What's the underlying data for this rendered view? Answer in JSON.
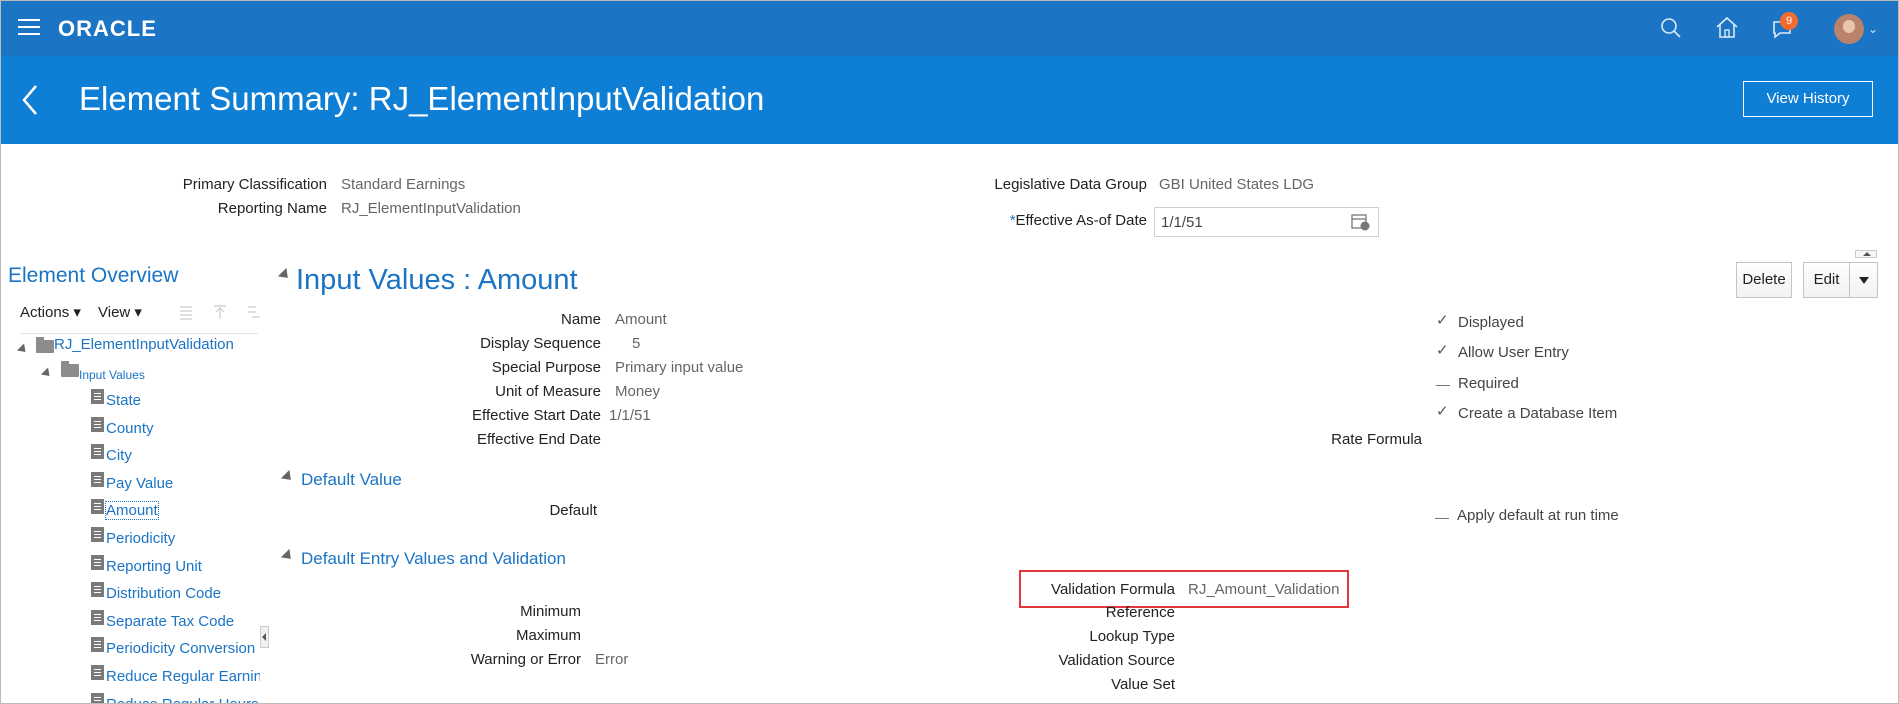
{
  "app": {
    "brand": "ORACLE",
    "notifications_count": "9",
    "icons": [
      "menu-icon",
      "search-icon",
      "home-icon",
      "notifications-icon",
      "avatar"
    ],
    "colors": {
      "header": "#1b74c4",
      "title_band": "#0f7fd6",
      "link": "#1b74c4",
      "highlight": "#e0383b"
    }
  },
  "page": {
    "title": "Element Summary: RJ_ElementInputValidation",
    "view_history_label": "View History"
  },
  "header_info": {
    "primary_classification_label": "Primary Classification",
    "primary_classification_value": "Standard Earnings",
    "reporting_name_label": "Reporting Name",
    "reporting_name_value": "RJ_ElementInputValidation",
    "ldg_label": "Legislative Data Group",
    "ldg_value": "GBI United States LDG",
    "effective_date_required_mark": "*",
    "effective_date_label": "Effective As-of Date",
    "effective_date_value": "1/1/51"
  },
  "left_panel": {
    "title": "Element Overview",
    "actions_label": "Actions",
    "view_label": "View",
    "tree": {
      "root": "RJ_ElementInputValidation",
      "folder": "Input Values",
      "items": [
        "State",
        "County",
        "City",
        "Pay Value",
        "Amount",
        "Periodicity",
        "Reporting Unit",
        "Distribution Code",
        "Separate Tax Code",
        "Periodicity Conversion",
        "Reduce Regular Earnings",
        "Reduce Regular Hours"
      ],
      "selected": "Amount"
    }
  },
  "main": {
    "section_title": "Input Values : Amount",
    "delete_label": "Delete",
    "edit_label": "Edit",
    "fields": {
      "name_label": "Name",
      "name_value": "Amount",
      "display_sequence_label": "Display Sequence",
      "display_sequence_value": "5",
      "special_purpose_label": "Special Purpose",
      "special_purpose_value": "Primary input value",
      "unit_of_measure_label": "Unit of Measure",
      "unit_of_measure_value": "Money",
      "effective_start_label": "Effective Start Date",
      "effective_start_value": "1/1/51",
      "effective_end_label": "Effective End Date",
      "rate_formula_label": "Rate Formula"
    },
    "flags": {
      "displayed": {
        "label": "Displayed",
        "checked": true
      },
      "allow_user_entry": {
        "label": "Allow User Entry",
        "checked": true
      },
      "required": {
        "label": "Required",
        "checked": false
      },
      "create_db_item": {
        "label": "Create a Database Item",
        "checked": true
      },
      "check_glyph": "✓"
    },
    "default_value": {
      "title": "Default Value",
      "default_label": "Default",
      "apply_default_label": "Apply default at run time"
    },
    "validation": {
      "title": "Default Entry Values and Validation",
      "validation_formula_label": "Validation Formula",
      "validation_formula_value": "RJ_Amount_Validation",
      "minimum_label": "Minimum",
      "maximum_label": "Maximum",
      "warning_error_label": "Warning or Error",
      "warning_error_value": "Error",
      "reference_label": "Reference",
      "lookup_type_label": "Lookup Type",
      "validation_source_label": "Validation Source",
      "value_set_label": "Value Set"
    }
  }
}
